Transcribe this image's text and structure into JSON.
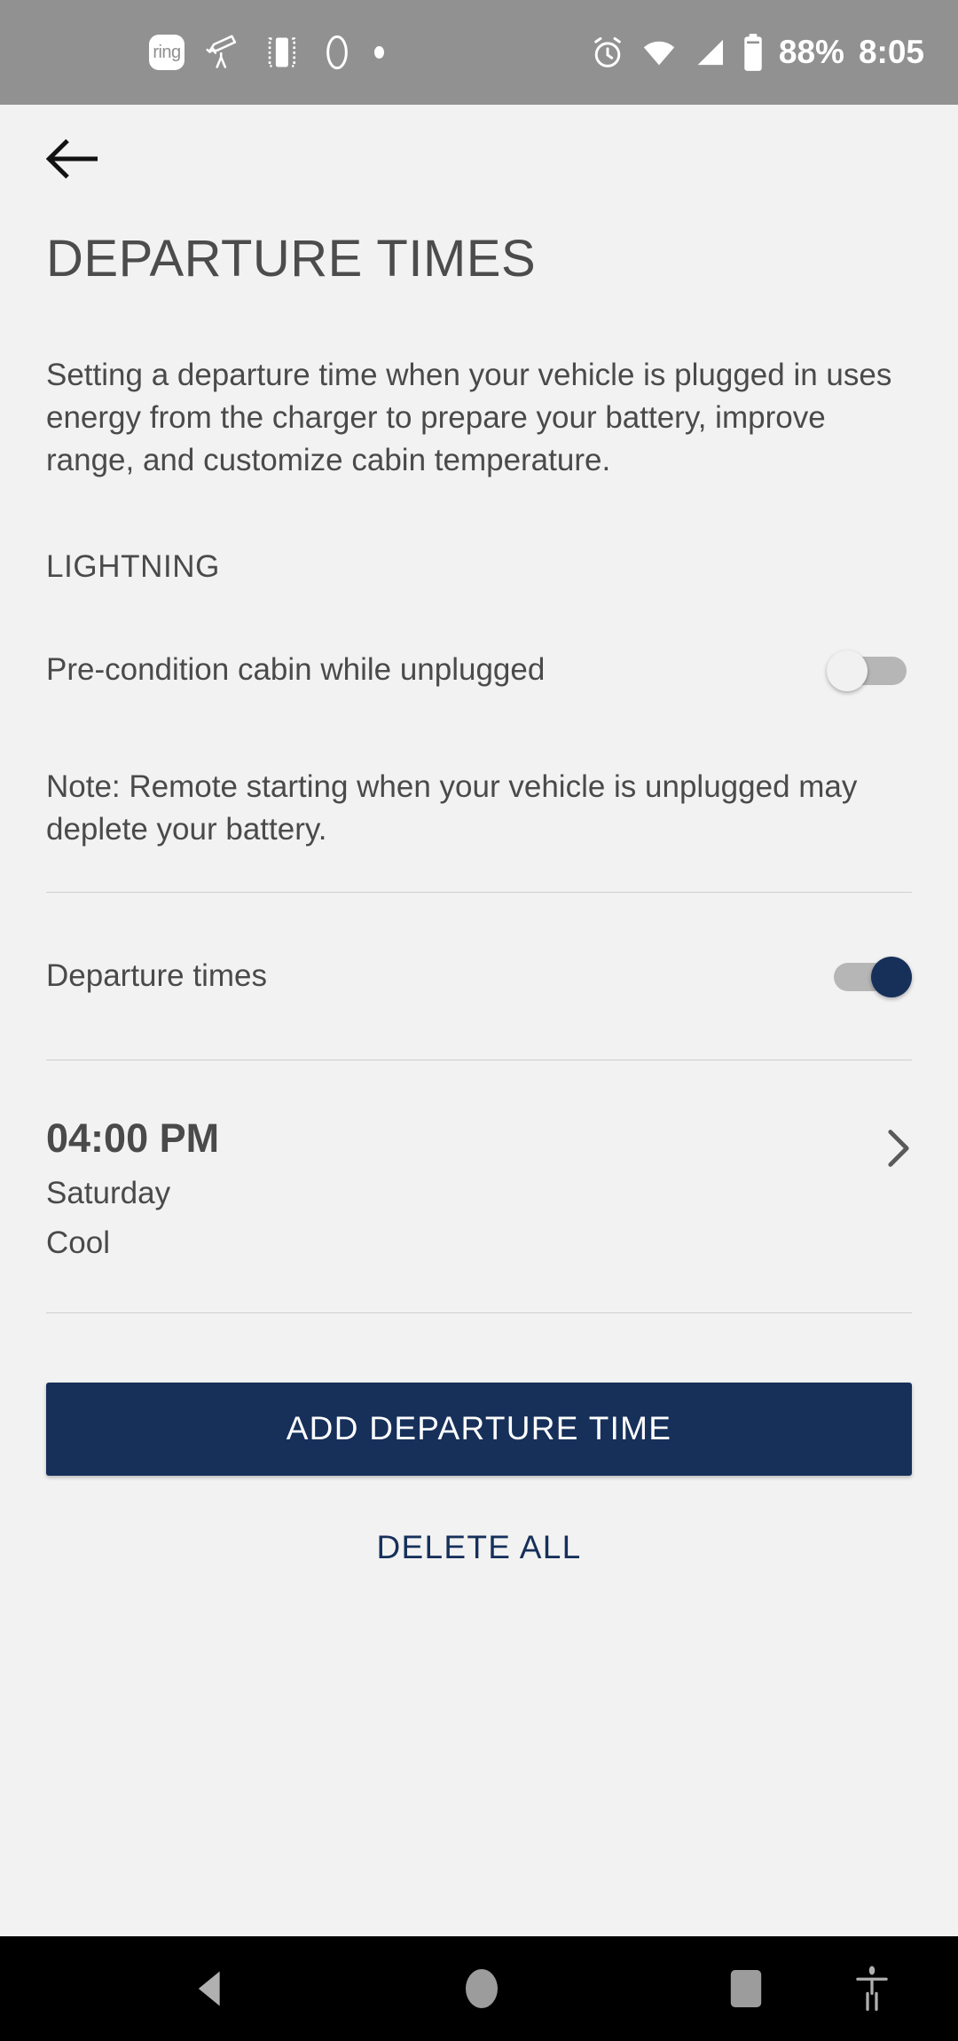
{
  "status_bar": {
    "left_icons": [
      {
        "name": "ring-app-icon",
        "label": "ring"
      },
      {
        "name": "telescope-icon",
        "label": ""
      },
      {
        "name": "screen-cast-icon",
        "label": ""
      },
      {
        "name": "assistant-icon",
        "label": ""
      },
      {
        "name": "more-notifications-dot-icon",
        "label": ""
      }
    ],
    "right_icons": [
      {
        "name": "alarm-icon"
      },
      {
        "name": "wifi-icon"
      },
      {
        "name": "signal-icon"
      },
      {
        "name": "battery-icon"
      }
    ],
    "battery": "88%",
    "time": "8:05"
  },
  "header": {
    "back_label": "Back",
    "title": "DEPARTURE TIMES"
  },
  "main": {
    "intro": "Setting a departure time when your vehicle is plugged in uses energy from the charger to prepare your battery, improve range, and customize cabin temperature.",
    "section_label": "LIGHTNING",
    "precondition": {
      "label": "Pre-condition cabin while unplugged",
      "state": "off"
    },
    "note": "Note: Remote starting when your vehicle is unplugged may deplete your battery.",
    "departure_times_toggle": {
      "label": "Departure times",
      "state": "on"
    },
    "entries": [
      {
        "time": "04:00 PM",
        "day": "Saturday",
        "mode": "Cool"
      }
    ],
    "add_button_label": "ADD DEPARTURE TIME",
    "delete_all_label": "DELETE ALL"
  },
  "nav_bar": {
    "back": "back-nav-button",
    "home": "home-nav-button",
    "recents": "recents-nav-button",
    "accessibility": "accessibility-nav-button"
  },
  "colors": {
    "brand_navy": "#16305a",
    "status_bar_bg": "#919191",
    "page_bg": "#f2f2f2",
    "text": "#4a4a4a"
  }
}
